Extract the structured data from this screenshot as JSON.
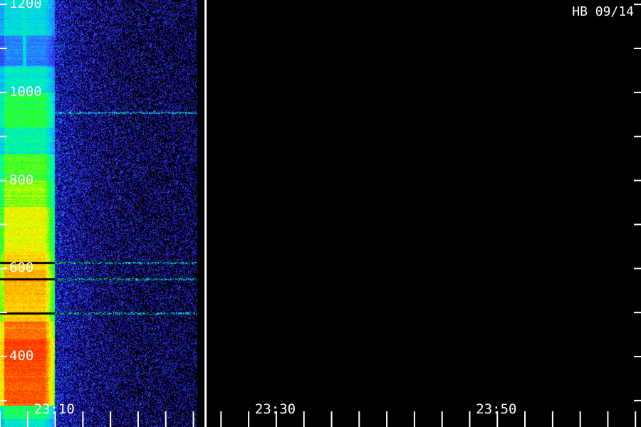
{
  "chart_data": {
    "type": "heatmap",
    "subtype": "spectrogram",
    "station_label": "HB 09/14",
    "y_axis": {
      "tick_labels": [
        "1200",
        "1000",
        "800",
        "600",
        "400"
      ],
      "tick_values": [
        1200,
        1000,
        800,
        600,
        400
      ],
      "range": [
        240,
        1210
      ],
      "minor_step": 100
    },
    "x_axis": {
      "tick_labels": [
        "23:10",
        "23:30",
        "23:50"
      ],
      "tick_values_min": [
        10,
        30,
        50
      ],
      "range_min": [
        5,
        63
      ],
      "minor_step_min": 2.5
    },
    "divider_time_min": 23.6,
    "data_end_time_min": 22.8,
    "emission_end_time_min": 9.9,
    "colormap": [
      "#000000",
      "#1a00c8",
      "#3a5bff",
      "#00c8ff",
      "#00ff9a",
      "#39ff14",
      "#ffff00",
      "#ff9900",
      "#ff2a00"
    ],
    "emission_bands": [
      {
        "from": 1130,
        "to": 1210,
        "level": 0.42
      },
      {
        "from": 1060,
        "to": 1130,
        "level": 0.3
      },
      {
        "from": 1000,
        "to": 1060,
        "level": 0.45
      },
      {
        "from": 920,
        "to": 1000,
        "level": 0.58
      },
      {
        "from": 860,
        "to": 920,
        "level": 0.48
      },
      {
        "from": 800,
        "to": 860,
        "level": 0.62
      },
      {
        "from": 740,
        "to": 800,
        "level": 0.68
      },
      {
        "from": 640,
        "to": 740,
        "level": 0.75
      },
      {
        "from": 600,
        "to": 640,
        "level": 0.8
      },
      {
        "from": 540,
        "to": 600,
        "level": 0.84
      },
      {
        "from": 480,
        "to": 540,
        "level": 0.82
      },
      {
        "from": 440,
        "to": 480,
        "level": 0.92
      },
      {
        "from": 360,
        "to": 440,
        "level": 0.98
      },
      {
        "from": 290,
        "to": 360,
        "level": 0.95
      },
      {
        "from": 260,
        "to": 290,
        "level": 0.55
      },
      {
        "from": 240,
        "to": 260,
        "level": 0.45
      }
    ],
    "dark_lines_freq": [
      613,
      576,
      499
    ],
    "bright_traces_freq": [
      613,
      576,
      499,
      955
    ],
    "interference_time_min": 7.2
  }
}
